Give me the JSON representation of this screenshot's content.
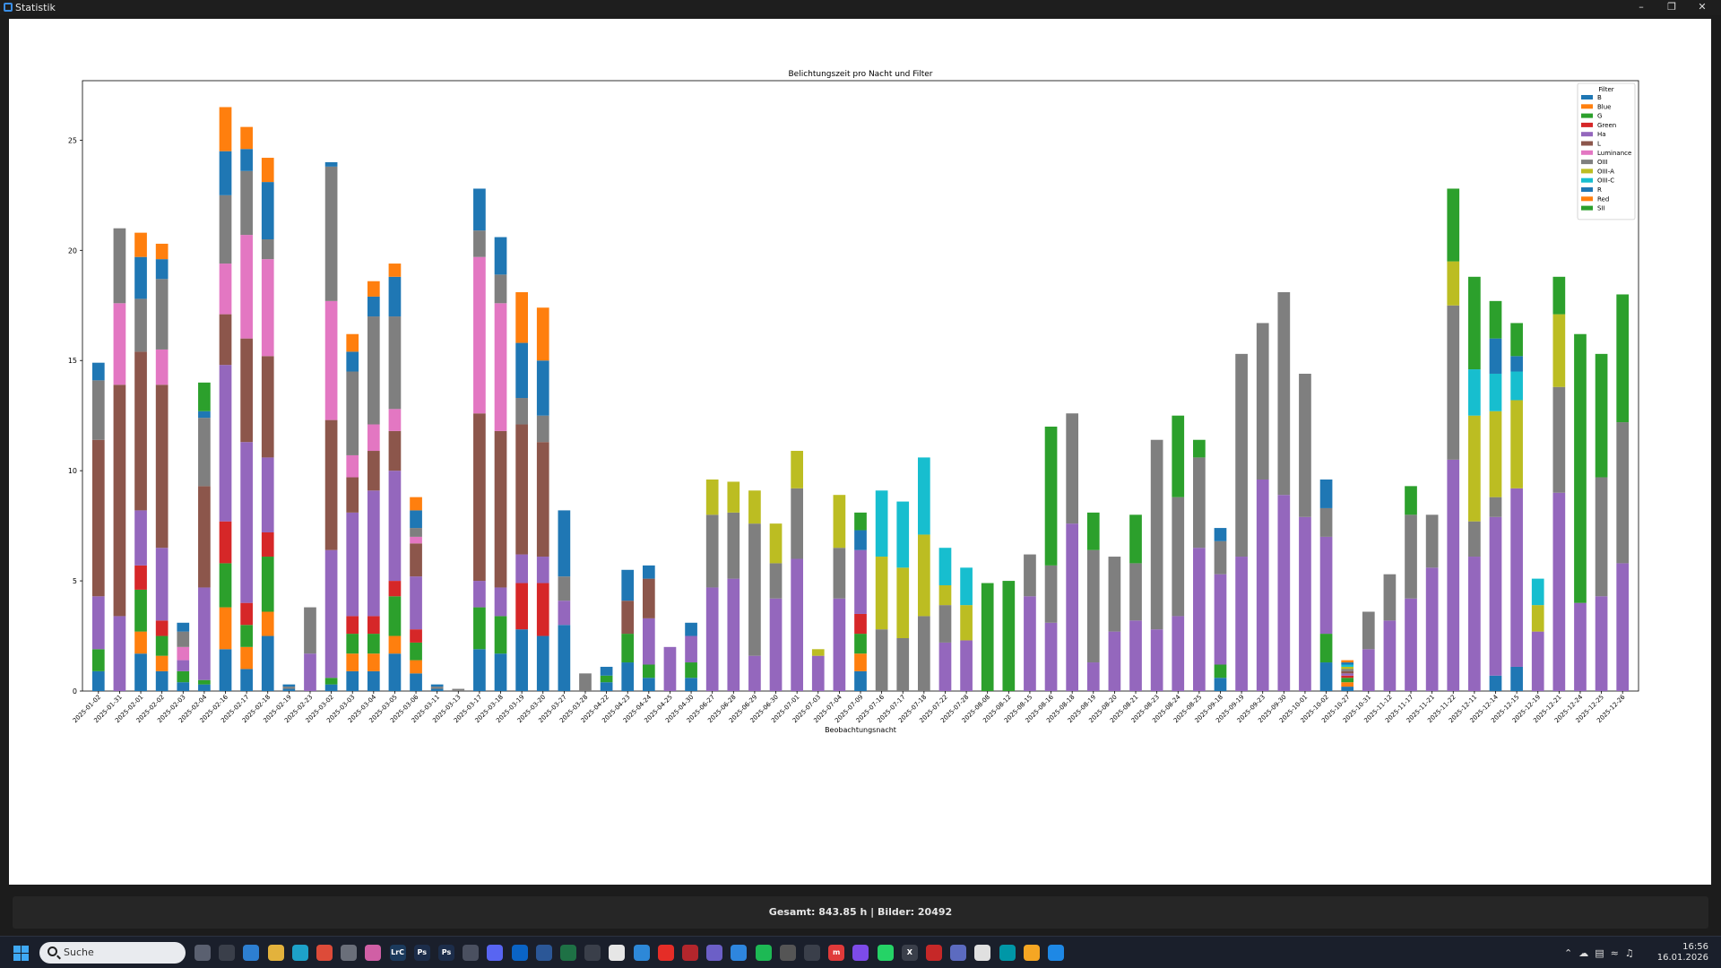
{
  "window": {
    "title": "Statistik"
  },
  "status": {
    "text": "Gesamt: 843.85 h | Bilder: 20492"
  },
  "taskbar": {
    "search_placeholder": "Suche",
    "time": "16:56",
    "date": "16.01.2026"
  },
  "chart_data": {
    "type": "bar",
    "stacked": true,
    "title": "Belichtungszeit pro Nacht und Filter",
    "xlabel": "Beobachtungsnacht",
    "ylabel": "",
    "ylim": [
      0,
      27.7
    ],
    "yticks": [
      0,
      5,
      10,
      15,
      20,
      25
    ],
    "grid": false,
    "legend": {
      "title": "Filter",
      "position": "top-right"
    },
    "categories": [
      "2025-01-02",
      "2025-01-31",
      "2025-02-01",
      "2025-02-02",
      "2025-02-03",
      "2025-02-04",
      "2025-02-16",
      "2025-02-17",
      "2025-02-18",
      "2025-02-19",
      "2025-02-23",
      "2025-03-02",
      "2025-03-03",
      "2025-03-04",
      "2025-03-05",
      "2025-03-06",
      "2025-03-11",
      "2025-03-13",
      "2025-03-17",
      "2025-03-18",
      "2025-03-19",
      "2025-03-20",
      "2025-03-27",
      "2025-03-28",
      "2025-04-22",
      "2025-04-23",
      "2025-04-24",
      "2025-04-25",
      "2025-04-30",
      "2025-06-27",
      "2025-06-28",
      "2025-06-29",
      "2025-06-30",
      "2025-07-01",
      "2025-07-03",
      "2025-07-04",
      "2025-07-09",
      "2025-07-16",
      "2025-07-17",
      "2025-07-18",
      "2025-07-22",
      "2025-07-28",
      "2025-08-08",
      "2025-08-12",
      "2025-08-15",
      "2025-08-16",
      "2025-08-18",
      "2025-08-19",
      "2025-08-20",
      "2025-08-21",
      "2025-08-23",
      "2025-08-24",
      "2025-08-25",
      "2025-09-18",
      "2025-09-19",
      "2025-09-23",
      "2025-09-30",
      "2025-10-01",
      "2025-10-02",
      "2025-10-27",
      "2025-10-31",
      "2025-11-12",
      "2025-11-17",
      "2025-11-21",
      "2025-11-22",
      "2025-12-11",
      "2025-12-14",
      "2025-12-15",
      "2025-12-19",
      "2025-12-21",
      "2025-12-24",
      "2025-12-25",
      "2025-12-26"
    ],
    "series": [
      {
        "name": "B",
        "color": "#1f77b4",
        "values": [
          0.9,
          0,
          1.7,
          0.9,
          0.4,
          0.3,
          1.9,
          1.0,
          2.5,
          0.1,
          0,
          0.3,
          0.9,
          0.9,
          1.7,
          0.8,
          0.1,
          0,
          1.9,
          1.7,
          2.8,
          2.5,
          3.0,
          0,
          0.4,
          1.3,
          0.6,
          0,
          0.6,
          0,
          0,
          0,
          0,
          0,
          0,
          0,
          0.9,
          0,
          0,
          0,
          0,
          0,
          0,
          0,
          0,
          0,
          0,
          0,
          0,
          0,
          0,
          0,
          0,
          0.6,
          0,
          0,
          0,
          0,
          1.3,
          0.2,
          0,
          0,
          0,
          0,
          0,
          0,
          0.7,
          1.1,
          0,
          0,
          0,
          0,
          0
        ]
      },
      {
        "name": "Blue",
        "color": "#ff7f0e",
        "values": [
          0,
          0,
          1.0,
          0.7,
          0,
          0,
          1.9,
          1.0,
          1.1,
          0,
          0,
          0,
          0.8,
          0.8,
          0.8,
          0.6,
          0,
          0,
          0,
          0,
          0,
          0,
          0,
          0,
          0,
          0,
          0,
          0,
          0,
          0,
          0,
          0,
          0,
          0,
          0,
          0,
          0.8,
          0,
          0,
          0,
          0,
          0,
          0,
          0,
          0,
          0,
          0,
          0,
          0,
          0,
          0,
          0,
          0,
          0,
          0,
          0,
          0,
          0,
          0,
          0.2,
          0,
          0,
          0,
          0,
          0,
          0,
          0,
          0,
          0,
          0,
          0,
          0,
          0
        ]
      },
      {
        "name": "G",
        "color": "#2ca02c",
        "values": [
          1.0,
          0,
          1.9,
          0.9,
          0.5,
          0.2,
          2.0,
          1.0,
          2.5,
          0,
          0,
          0.3,
          0.9,
          0.9,
          1.8,
          0.8,
          0,
          0,
          1.9,
          1.7,
          0,
          0,
          0,
          0,
          0.3,
          1.3,
          0.6,
          0,
          0.7,
          0,
          0,
          0,
          0,
          0,
          0,
          0,
          0.9,
          0,
          0,
          0,
          0,
          0,
          0,
          0,
          0,
          0,
          0,
          0,
          0,
          0,
          0,
          0,
          0,
          0.6,
          0,
          0,
          0,
          0,
          1.3,
          0.2,
          0,
          0,
          0,
          0,
          0,
          0,
          0,
          0,
          0,
          0,
          0,
          0,
          0
        ]
      },
      {
        "name": "Green",
        "color": "#d62728",
        "values": [
          0,
          0,
          1.1,
          0.7,
          0,
          0,
          1.9,
          1.0,
          1.1,
          0,
          0,
          0,
          0.8,
          0.8,
          0.7,
          0.6,
          0,
          0,
          0,
          0,
          2.1,
          2.4,
          0,
          0,
          0,
          0,
          0,
          0,
          0,
          0,
          0,
          0,
          0,
          0,
          0,
          0,
          0.9,
          0,
          0,
          0,
          0,
          0,
          0,
          0,
          0,
          0,
          0,
          0,
          0,
          0,
          0,
          0,
          0,
          0,
          0,
          0,
          0,
          0,
          0,
          0.1,
          0,
          0,
          0,
          0,
          0,
          0,
          0,
          0,
          0,
          0,
          0,
          0,
          0
        ]
      },
      {
        "name": "Ha",
        "color": "#9467bd",
        "values": [
          2.4,
          3.4,
          2.5,
          3.3,
          0.5,
          4.2,
          7.1,
          7.3,
          3.4,
          0,
          1.7,
          5.8,
          4.7,
          5.7,
          5.0,
          2.4,
          0,
          0,
          1.2,
          1.3,
          1.3,
          1.2,
          1.1,
          0,
          0,
          0,
          2.1,
          2.0,
          1.2,
          4.7,
          5.1,
          1.6,
          4.2,
          6.0,
          1.6,
          4.2,
          2.9,
          0,
          0,
          0,
          2.2,
          2.3,
          0,
          0,
          4.3,
          3.1,
          7.6,
          1.3,
          2.7,
          3.2,
          2.8,
          3.4,
          6.5,
          4.1,
          6.1,
          9.6,
          8.9,
          7.9,
          4.4,
          0.1,
          1.9,
          3.2,
          4.2,
          5.6,
          10.5,
          6.1,
          7.2,
          8.1,
          2.7,
          9.0,
          4.0,
          4.3,
          5.8
        ]
      },
      {
        "name": "L",
        "color": "#8c564b",
        "values": [
          7.1,
          10.5,
          7.2,
          7.4,
          0,
          4.6,
          2.3,
          4.7,
          4.6,
          0,
          0,
          5.9,
          1.6,
          1.8,
          1.8,
          1.5,
          0,
          0,
          7.6,
          7.1,
          5.9,
          5.2,
          0,
          0,
          0,
          1.5,
          1.8,
          0,
          0,
          0,
          0,
          0,
          0,
          0,
          0,
          0,
          0,
          0,
          0,
          0,
          0,
          0,
          0,
          0,
          0,
          0,
          0,
          0,
          0,
          0,
          0,
          0,
          0,
          0,
          0,
          0,
          0,
          0,
          0,
          0.1,
          0,
          0,
          0,
          0,
          0,
          0,
          0,
          0,
          0,
          0,
          0,
          0,
          0
        ]
      },
      {
        "name": "Luminance",
        "color": "#e377c2",
        "values": [
          0,
          3.7,
          0,
          1.6,
          0.6,
          0,
          2.3,
          4.7,
          4.4,
          0,
          0,
          5.4,
          1.0,
          1.2,
          1.0,
          0.3,
          0,
          0,
          7.1,
          5.8,
          0,
          0,
          0,
          0,
          0,
          0,
          0,
          0,
          0,
          0,
          0,
          0,
          0,
          0,
          0,
          0,
          0,
          0,
          0,
          0,
          0,
          0,
          0,
          0,
          0,
          0,
          0,
          0,
          0,
          0,
          0,
          0,
          0,
          0,
          0,
          0,
          0,
          0,
          0,
          0,
          0,
          0,
          0,
          0,
          0,
          0,
          0,
          0,
          0,
          0,
          0,
          0,
          0
        ]
      },
      {
        "name": "OIII",
        "color": "#7f7f7f",
        "values": [
          2.7,
          3.4,
          2.4,
          3.2,
          0.7,
          3.1,
          3.1,
          2.9,
          0.9,
          0.1,
          2.1,
          6.1,
          3.8,
          4.9,
          4.2,
          0.4,
          0.1,
          0.1,
          1.2,
          1.3,
          1.2,
          1.2,
          1.1,
          0.8,
          0,
          0,
          0,
          0,
          0,
          3.3,
          3.0,
          6.0,
          1.6,
          3.2,
          0,
          2.3,
          0,
          2.8,
          2.4,
          3.4,
          1.7,
          0,
          0,
          0,
          1.9,
          2.6,
          5.0,
          5.1,
          3.4,
          2.6,
          8.6,
          5.4,
          4.1,
          1.5,
          9.2,
          7.1,
          9.2,
          6.5,
          1.3,
          0.1,
          1.7,
          2.1,
          3.8,
          2.4,
          7.0,
          1.6,
          0.9,
          0,
          0,
          4.8,
          0,
          5.4,
          6.4
        ]
      },
      {
        "name": "OIII-A",
        "color": "#bcbd22",
        "values": [
          0,
          0,
          0,
          0,
          0,
          0,
          0,
          0,
          0,
          0,
          0,
          0,
          0,
          0,
          0,
          0,
          0,
          0,
          0,
          0,
          0,
          0,
          0,
          0,
          0,
          0,
          0,
          0,
          0,
          1.6,
          1.4,
          1.5,
          1.8,
          1.7,
          0.3,
          2.4,
          0,
          3.3,
          3.2,
          3.7,
          0.9,
          1.6,
          0,
          0,
          0,
          0,
          0,
          0,
          0,
          0,
          0,
          0,
          0,
          0,
          0,
          0,
          0,
          0,
          0,
          0.1,
          0,
          0,
          0,
          0,
          2.0,
          4.8,
          3.9,
          4.0,
          1.2,
          3.3,
          0,
          0,
          0
        ]
      },
      {
        "name": "OIII-C",
        "color": "#17becf",
        "values": [
          0,
          0,
          0,
          0,
          0,
          0,
          0,
          0,
          0,
          0,
          0,
          0,
          0,
          0,
          0,
          0,
          0,
          0,
          0,
          0,
          0,
          0,
          0,
          0,
          0,
          0,
          0,
          0,
          0,
          0,
          0,
          0,
          0,
          0,
          0,
          0,
          0,
          3.0,
          3.0,
          3.5,
          1.7,
          1.7,
          0,
          0,
          0,
          0,
          0,
          0,
          0,
          0,
          0,
          0,
          0,
          0,
          0,
          0,
          0,
          0,
          0,
          0.1,
          0,
          0,
          0,
          0,
          0,
          2.1,
          1.7,
          1.3,
          1.2,
          0,
          0,
          0,
          0
        ]
      },
      {
        "name": "R",
        "color": "#1f77b4",
        "values": [
          0.8,
          0,
          1.9,
          0.9,
          0.4,
          0.3,
          2.0,
          1.0,
          2.6,
          0.1,
          0,
          0.2,
          0.9,
          0.9,
          1.8,
          0.8,
          0.1,
          0,
          1.9,
          1.7,
          2.5,
          2.5,
          3.0,
          0,
          0.4,
          1.4,
          0.6,
          0,
          0.6,
          0,
          0,
          0,
          0,
          0,
          0,
          0,
          0.9,
          0,
          0,
          0,
          0,
          0,
          0,
          0,
          0,
          0,
          0,
          0,
          0,
          0,
          0,
          0,
          0,
          0.6,
          0,
          0,
          0,
          0,
          1.3,
          0.1,
          0,
          0,
          0,
          0,
          0,
          0,
          1.6,
          0.7,
          0,
          0,
          0,
          0,
          0
        ]
      },
      {
        "name": "Red",
        "color": "#ff7f0e",
        "values": [
          0,
          0,
          1.1,
          0.7,
          0,
          0,
          2.0,
          1.0,
          1.1,
          0,
          0,
          0,
          0.8,
          0.7,
          0.6,
          0.6,
          0,
          0,
          0,
          0,
          2.3,
          2.4,
          0,
          0,
          0,
          0,
          0,
          0,
          0,
          0,
          0,
          0,
          0,
          0,
          0,
          0,
          0,
          0,
          0,
          0,
          0,
          0,
          0,
          0,
          0,
          0,
          0,
          0,
          0,
          0,
          0,
          0,
          0,
          0,
          0,
          0,
          0,
          0,
          0,
          0.1,
          0,
          0,
          0,
          0,
          0,
          0,
          0,
          0,
          0,
          0,
          0,
          0,
          0
        ]
      },
      {
        "name": "SII",
        "color": "#2ca02c",
        "values": [
          0,
          0,
          0,
          0,
          0,
          1.3,
          0,
          0,
          0,
          0,
          0,
          0,
          0,
          0,
          0,
          0,
          0,
          0,
          0,
          0,
          0,
          0,
          0,
          0,
          0,
          0,
          0,
          0,
          0,
          0,
          0,
          0,
          0,
          0,
          0,
          0,
          0.8,
          0,
          0,
          0,
          0,
          0,
          4.9,
          5.0,
          0,
          6.3,
          0,
          1.7,
          0,
          2.2,
          0,
          3.7,
          0.8,
          0,
          0,
          0,
          0,
          0,
          0,
          0,
          0,
          0,
          1.3,
          0,
          3.3,
          4.2,
          1.7,
          1.5,
          0,
          1.7,
          12.2,
          5.6,
          5.8
        ]
      }
    ]
  }
}
